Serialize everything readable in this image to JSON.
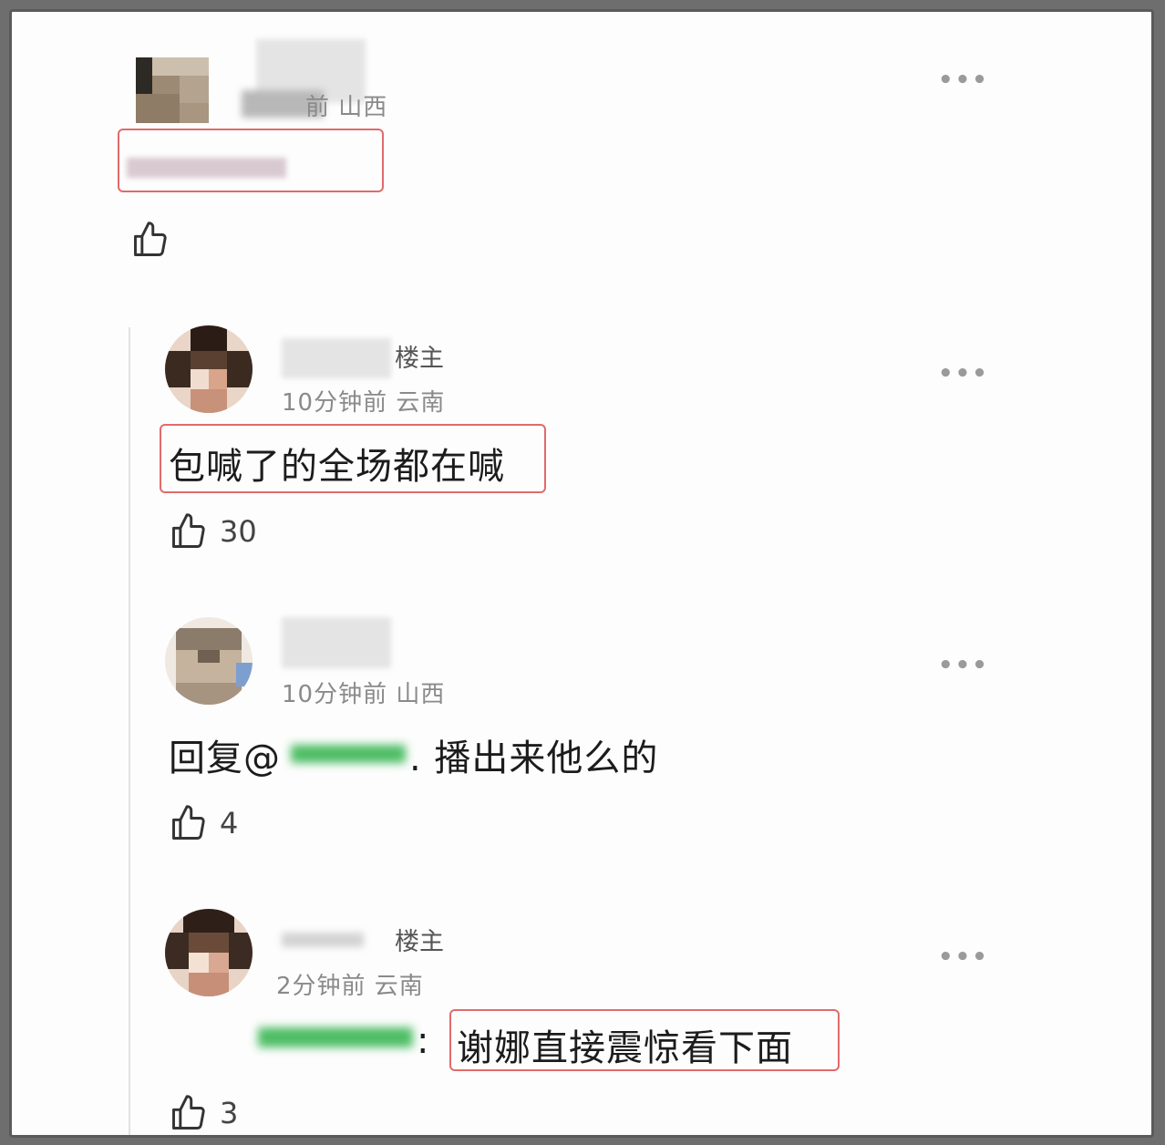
{
  "comments": [
    {
      "meta": "前 山西",
      "owner_tag": "",
      "content": "",
      "like_count": ""
    },
    {
      "meta": "10分钟前 云南",
      "owner_tag": "楼主",
      "content": "包喊了的全场都在喊",
      "like_count": "30"
    },
    {
      "meta": "10分钟前 山西",
      "owner_tag": "",
      "content_prefix": "回复@",
      "content_suffix": ".  播出来他么的",
      "like_count": "4"
    },
    {
      "meta": "2分钟前 云南",
      "owner_tag": "楼主",
      "content_colon": ":",
      "content": "谢娜直接震惊看下面",
      "like_count": "3"
    }
  ],
  "more_label": "•••",
  "icons": {
    "like": "thumbs-up-icon",
    "more": "more-dots-icon"
  },
  "colors": {
    "highlight_border": "#e06b6b",
    "mention_green": "#2fb24a",
    "meta_gray": "#8a8a8a"
  }
}
